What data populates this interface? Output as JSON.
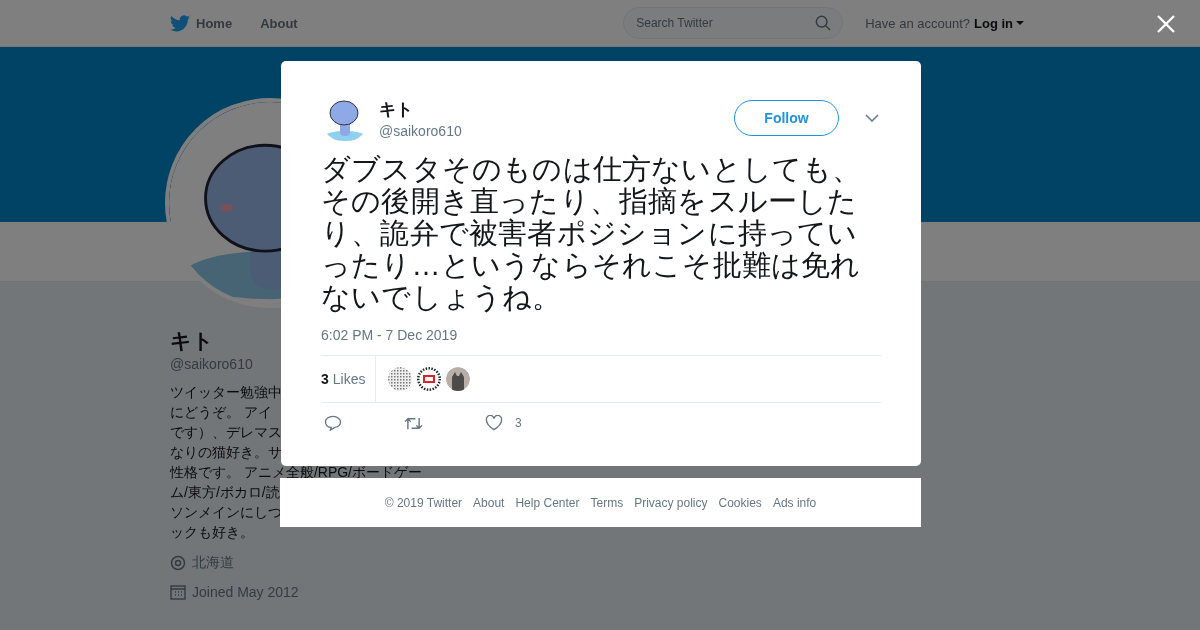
{
  "nav": {
    "items": [
      {
        "label": "Home",
        "kind": "logo"
      },
      {
        "label": "About",
        "kind": "plain"
      }
    ],
    "search": {
      "placeholder": "Search Twitter"
    },
    "account_prompt": "Have an account?",
    "login": "Log in"
  },
  "profile": {
    "name": "キト",
    "handle": "@saikoro610",
    "bio_lines": [
      "ツイッター勉強中",
      "にどうぞ。 アイ",
      "です）、デレマス",
      "なりの猫好き。サ",
      "性格です。 アニメ全般/RPG/ボードゲー",
      "ム/東方/ボカロ/読",
      "ソンメインにしつ",
      "ックも好き。"
    ],
    "location": "北海道",
    "joined": "Joined May 2012"
  },
  "tweet": {
    "name": "キト",
    "handle": "@saikoro610",
    "follow": "Follow",
    "text": "ダブスタそのものは仕方ないとしても、その後開き直ったり、指摘をスルーしたり、詭弁で被害者ポジションに持っていったり…というならそれこそ批難は免れないでしょうね。",
    "time": "6:02 PM - 7 Dec 2019",
    "likes_count": "3",
    "likes_label": "Likes",
    "likers": [
      {
        "kind": "grid"
      },
      {
        "kind": "badge"
      },
      {
        "kind": "cat"
      }
    ],
    "like_action_count": "3"
  },
  "footer": [
    "© 2019 Twitter",
    "About",
    "Help Center",
    "Terms",
    "Privacy policy",
    "Cookies",
    "Ads info"
  ]
}
